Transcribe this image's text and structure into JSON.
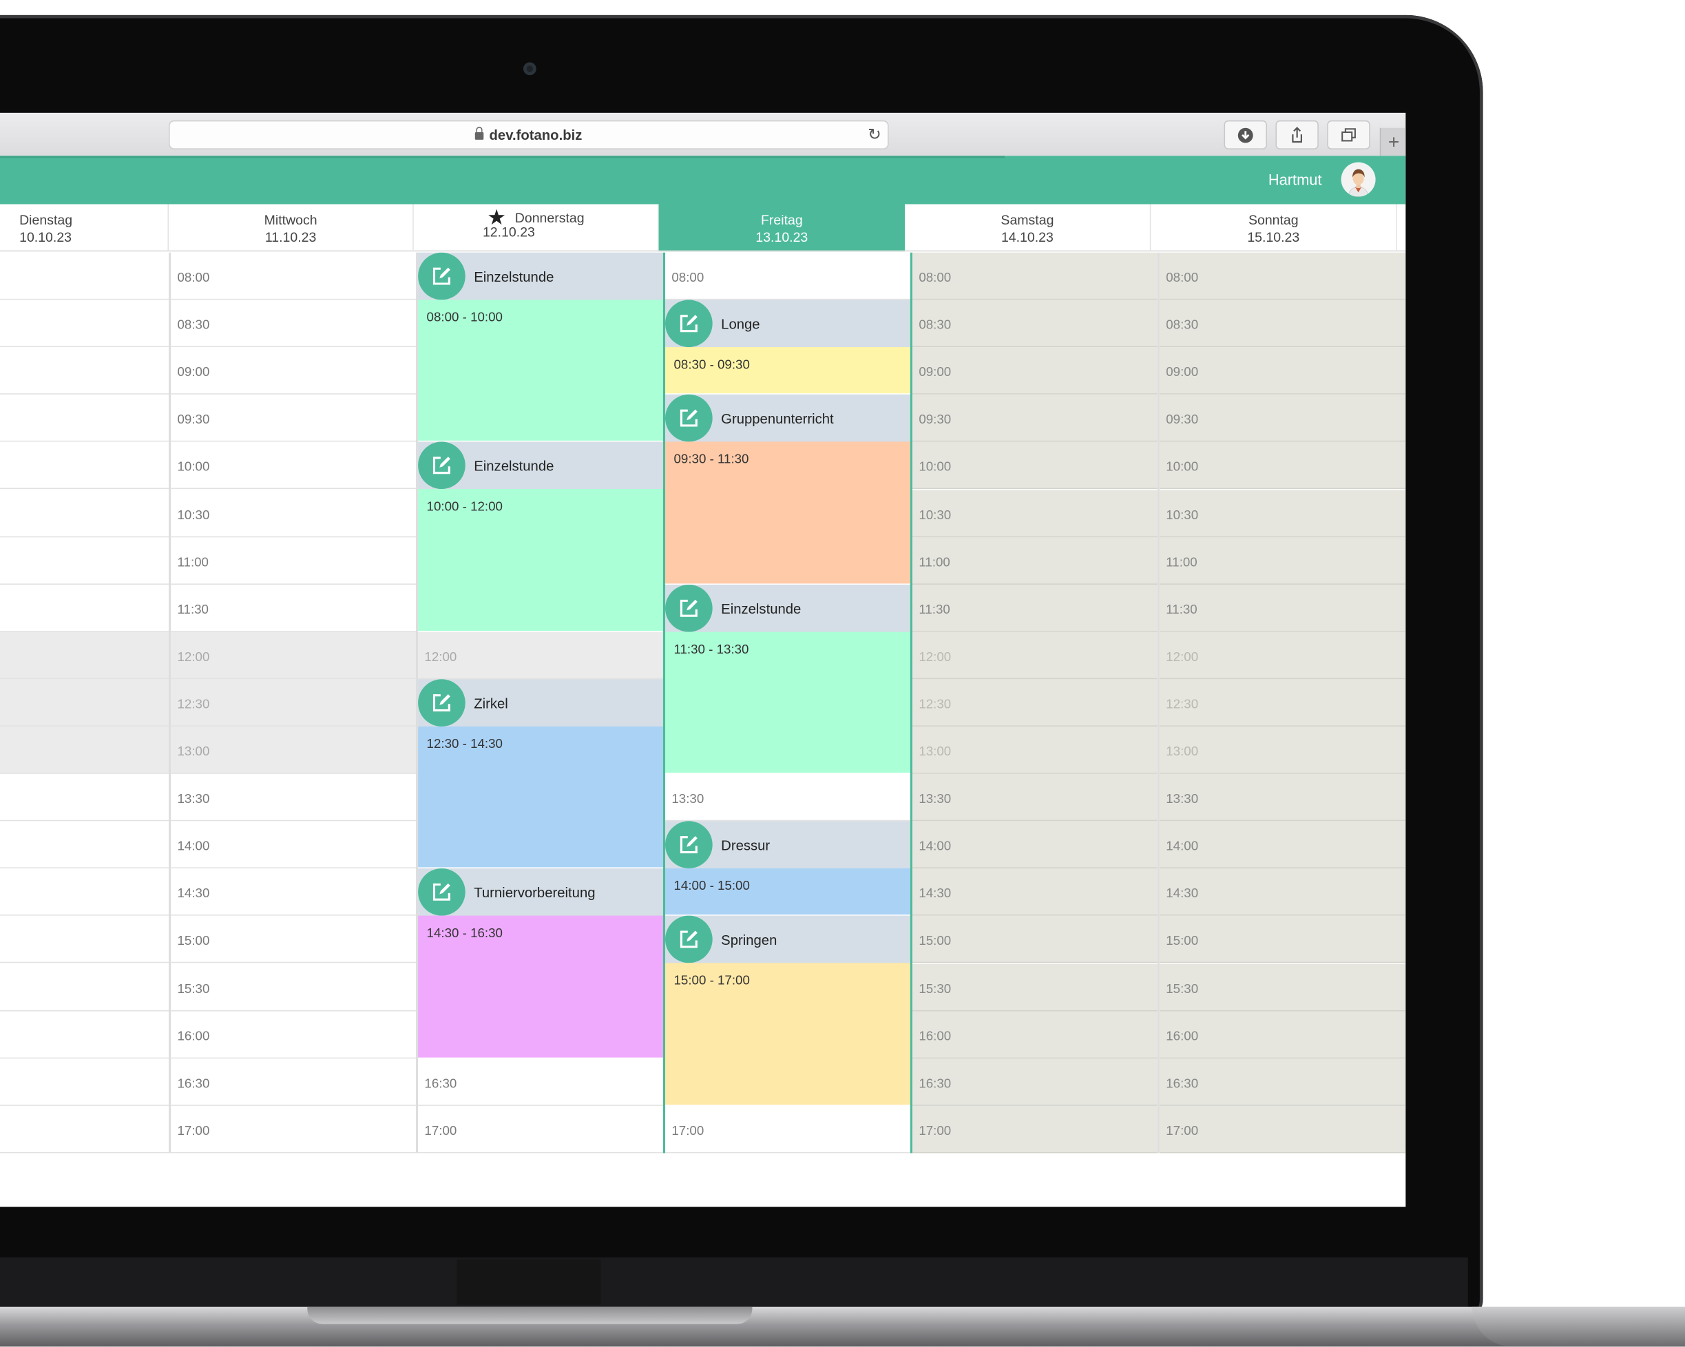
{
  "browser": {
    "url": "dev.fotano.biz"
  },
  "app": {
    "user_name": "Hartmut"
  },
  "colors": {
    "accent": "#4cba9a",
    "einzelstunde": "#aaffd6",
    "longe": "#fff5a8",
    "gruppenunterricht": "#ffcaa8",
    "zirkel": "#aad2f5",
    "turniervorbereitung": "#efaafd",
    "dressur": "#aad2f5",
    "springen": "#ffe9a8"
  },
  "days": [
    {
      "name": "Dienstag",
      "date": "10.10.23"
    },
    {
      "name": "Mittwoch",
      "date": "11.10.23"
    },
    {
      "name": "Donnerstag",
      "date": "12.10.23",
      "starred": true
    },
    {
      "name": "Freitag",
      "date": "13.10.23",
      "today": true
    },
    {
      "name": "Samstag",
      "date": "14.10.23"
    },
    {
      "name": "Sonntag",
      "date": "15.10.23"
    }
  ],
  "times": [
    "08:00",
    "08:30",
    "09:00",
    "09:30",
    "10:00",
    "10:30",
    "11:00",
    "11:30",
    "12:00",
    "12:30",
    "13:00",
    "13:30",
    "14:00",
    "14:30",
    "15:00",
    "15:30",
    "16:00",
    "16:30",
    "17:00"
  ],
  "events": {
    "donnerstag": [
      {
        "title": "Einzelstunde",
        "time": "08:00 - 10:00",
        "color": "#aaffd6"
      },
      {
        "title": "Einzelstunde",
        "time": "10:00 - 12:00",
        "color": "#aaffd6"
      },
      {
        "title": "Zirkel",
        "time": "12:30 - 14:30",
        "color": "#aad2f5"
      },
      {
        "title": "Turniervorbereitung",
        "time": "14:30 - 16:30",
        "color": "#efaafd"
      }
    ],
    "freitag": [
      {
        "title": "Longe",
        "time": "08:30 - 09:30",
        "color": "#fff5a8"
      },
      {
        "title": "Gruppenunterricht",
        "time": "09:30 - 11:30",
        "color": "#ffcaa8"
      },
      {
        "title": "Einzelstunde",
        "time": "11:30 - 13:30",
        "color": "#aaffd6"
      },
      {
        "title": "Dressur",
        "time": "14:00 - 15:00",
        "color": "#aad2f5"
      },
      {
        "title": "Springen",
        "time": "15:00 - 17:00",
        "color": "#ffe9a8"
      }
    ]
  }
}
